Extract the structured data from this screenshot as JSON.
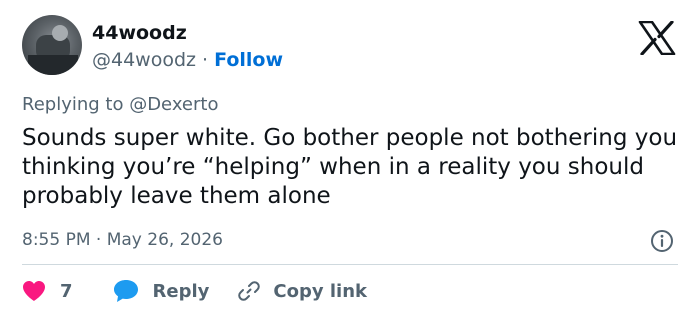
{
  "author": {
    "display_name": "44woodz",
    "handle": "@44woodz",
    "separator": "·",
    "follow_label": "Follow"
  },
  "tweet": {
    "replying_to": "Replying to @Dexerto",
    "text": "Sounds super white. Go bother people not bothering you thinking you’re “helping” when in a reality you should probably leave them alone",
    "timestamp": "8:55 PM · May 26, 2026"
  },
  "actions": {
    "like_count": "7",
    "reply_label": "Reply",
    "copy_link_label": "Copy link"
  },
  "colors": {
    "like": "#f91880",
    "reply": "#1d9bf0",
    "follow": "#006fd6",
    "secondary_text": "#536471"
  },
  "icons": [
    "x-logo-icon",
    "info-icon",
    "heart-icon",
    "reply-bubble-icon",
    "link-icon"
  ]
}
